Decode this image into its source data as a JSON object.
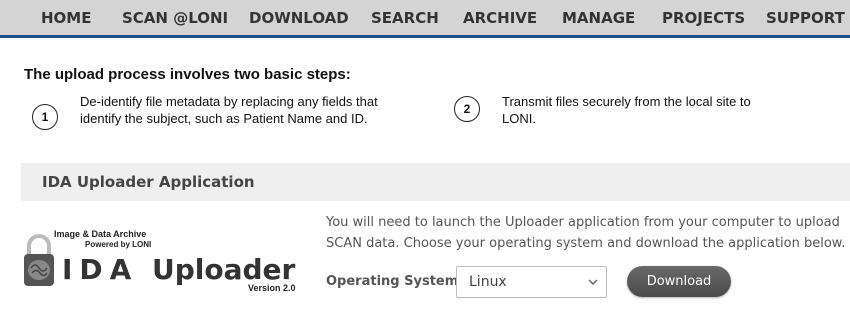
{
  "nav": {
    "items": [
      "HOME",
      "SCAN @LONI",
      "DOWNLOAD",
      "SEARCH",
      "ARCHIVE",
      "MANAGE",
      "PROJECTS",
      "SUPPORT"
    ],
    "accent_color": "#1e4f8c"
  },
  "steps": {
    "title": "The upload process involves two basic steps:",
    "items": [
      {
        "number": "1",
        "text": "De-identify file metadata by replacing any fields that identify the subject, such as Patient Name and ID."
      },
      {
        "number": "2",
        "text": "Transmit files securely from the local site to LONI."
      }
    ]
  },
  "uploader": {
    "section_title": "IDA Uploader Application",
    "logo": {
      "tagline1": "Image & Data Archive",
      "tagline2": "Powered by LONI",
      "name_ida": "IDA",
      "name_uploader": "Uploader",
      "version": "Version 2.0",
      "icon": "padlock-brain-icon"
    },
    "intro": "You will need to launch the Uploader application from your computer to upload SCAN data. Choose your operating system and download the application below.",
    "os_label": "Operating System",
    "os_selected": "Linux",
    "download_label": "Download"
  }
}
